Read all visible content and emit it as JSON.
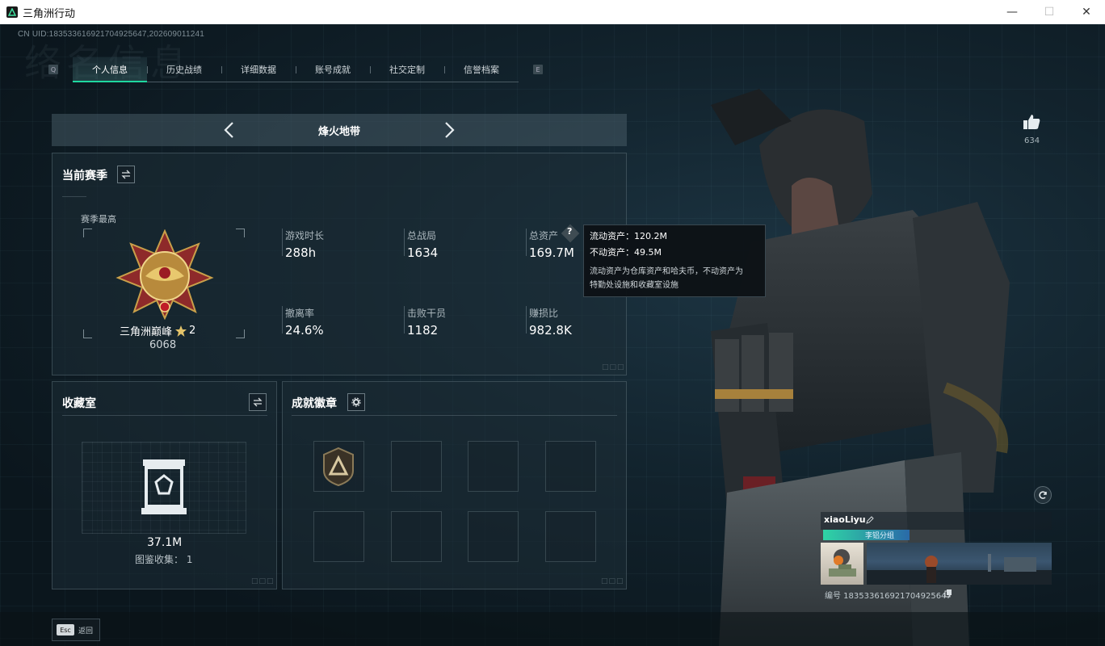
{
  "window": {
    "title": "三角洲行动",
    "min": "—",
    "max": "☐",
    "close": "✕"
  },
  "uid_line": "CN UID:18353361692170492564​7,202609011241",
  "watermark": "络名信息",
  "tabs": {
    "left_key": "Q",
    "right_key": "E",
    "items": [
      "个人信息",
      "历史战绩",
      "详细数据",
      "账号成就",
      "社交定制",
      "信誉档案"
    ],
    "active_index": 0
  },
  "mode": {
    "title": "烽火地带"
  },
  "season": {
    "title": "当前赛季",
    "best_label": "赛季最高",
    "rank_name": "三角洲巅峰",
    "rank_stars": "2",
    "rank_score": "6068",
    "stats": [
      {
        "label": "游戏时长",
        "value": "288h"
      },
      {
        "label": "总战局",
        "value": "1634"
      },
      {
        "label": "总资产",
        "value": "169.7M"
      },
      {
        "label": "撤离率",
        "value": "24.6%"
      },
      {
        "label": "击败干员",
        "value": "1182"
      },
      {
        "label": "赚损比",
        "value": "982.8K"
      }
    ]
  },
  "tooltip": {
    "liquid": "流动资产：120.2M",
    "fixed": "不动资产：49.5M",
    "desc1": "流动资产为仓库资产和哈夫币，不动资产为",
    "desc2": "特勤处设施和收藏室设施"
  },
  "vault": {
    "title": "收藏室",
    "value": "37.1M",
    "collection": "图鉴收集：  1"
  },
  "badges": {
    "title": "成就徽章"
  },
  "like": {
    "count": "634"
  },
  "profile": {
    "name": "xiaoLiyu",
    "group": "李铝分组",
    "uid": "编号 183533616921704925647"
  },
  "footer": {
    "esc_key": "Esc",
    "esc_label": "返回"
  },
  "colors": {
    "accent": "#1fd8a0",
    "panel": "#1e2d37"
  }
}
